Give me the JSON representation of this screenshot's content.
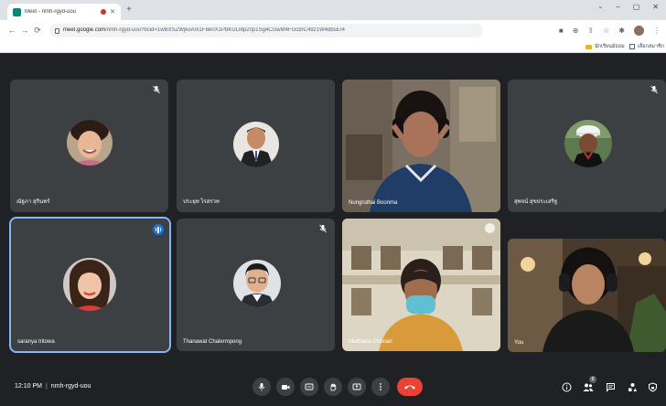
{
  "browser": {
    "tab_title": "Meet - nmh-rgyd-uou",
    "url_host": "meet.google.com",
    "url_path": "/nmh-rgyd-uou?bcid=1wBXSZWjkoAm1F8e0X1PbKULI8p20p1Sg4CGwM4FGcbrC49z1W4dbsEr4",
    "bookmarks": [
      {
        "label": "นักเรียนมัธยม"
      },
      {
        "label": "เลือกสมาชิก"
      }
    ]
  },
  "participants": [
    {
      "name": "ณัฐภา สุกินทร์",
      "muted": true
    },
    {
      "name": "ประยุท ไรสรวท",
      "muted": false
    },
    {
      "name": "Nungruthai Boonma",
      "muted": false
    },
    {
      "name": "สุพจน์ สุขประเสริฐ",
      "muted": true
    },
    {
      "name": "saranya tritowa",
      "muted": false,
      "speaking": true
    },
    {
      "name": "Thanawat Chalermpong",
      "muted": true
    },
    {
      "name": "Matthana Chunari",
      "muted": false
    },
    {
      "name": "You",
      "muted": false
    }
  ],
  "bottom_bar": {
    "time": "12:10 PM",
    "meeting_code": "nmh-rgyd-uou",
    "participant_count": "8"
  },
  "colors": {
    "stage_bg": "#202124",
    "tile_bg": "#3c4043",
    "speaking_outline": "#8ab4f8",
    "hangup_red": "#ea4335"
  }
}
